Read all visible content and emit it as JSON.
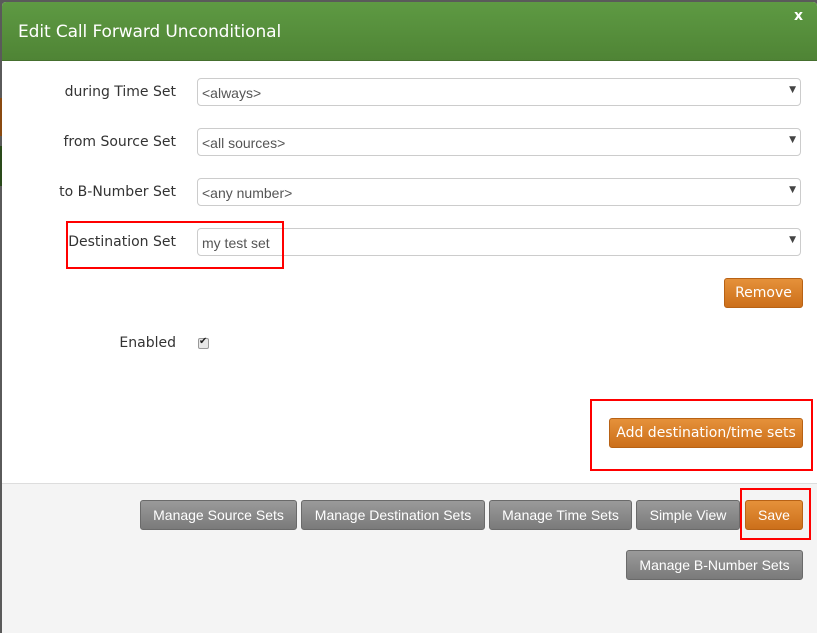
{
  "modal": {
    "title": "Edit Call Forward Unconditional",
    "close_label": "x"
  },
  "form": {
    "rows": [
      {
        "label": "during Time Set",
        "value": "<always>"
      },
      {
        "label": "from Source Set",
        "value": "<all sources>"
      },
      {
        "label": "to B-Number Set",
        "value": "<any number>"
      },
      {
        "label": "Destination Set",
        "value": "my test set"
      }
    ],
    "caret": "▼",
    "remove_label": "Remove",
    "enabled_label": "Enabled",
    "enabled_checked": true,
    "checkmark": "✔",
    "add_label": "Add destination/time sets"
  },
  "footer": {
    "buttons": [
      {
        "label": "Manage Source Sets"
      },
      {
        "label": "Manage Destination Sets"
      },
      {
        "label": "Manage Time Sets"
      },
      {
        "label": "Simple View"
      },
      {
        "label": "Save"
      },
      {
        "label": "Manage B-Number Sets"
      }
    ]
  },
  "colors": {
    "header_green": "#5a9440",
    "primary_orange": "#d97c24",
    "secondary_gray": "#888888",
    "highlight_red": "#ff0000"
  }
}
